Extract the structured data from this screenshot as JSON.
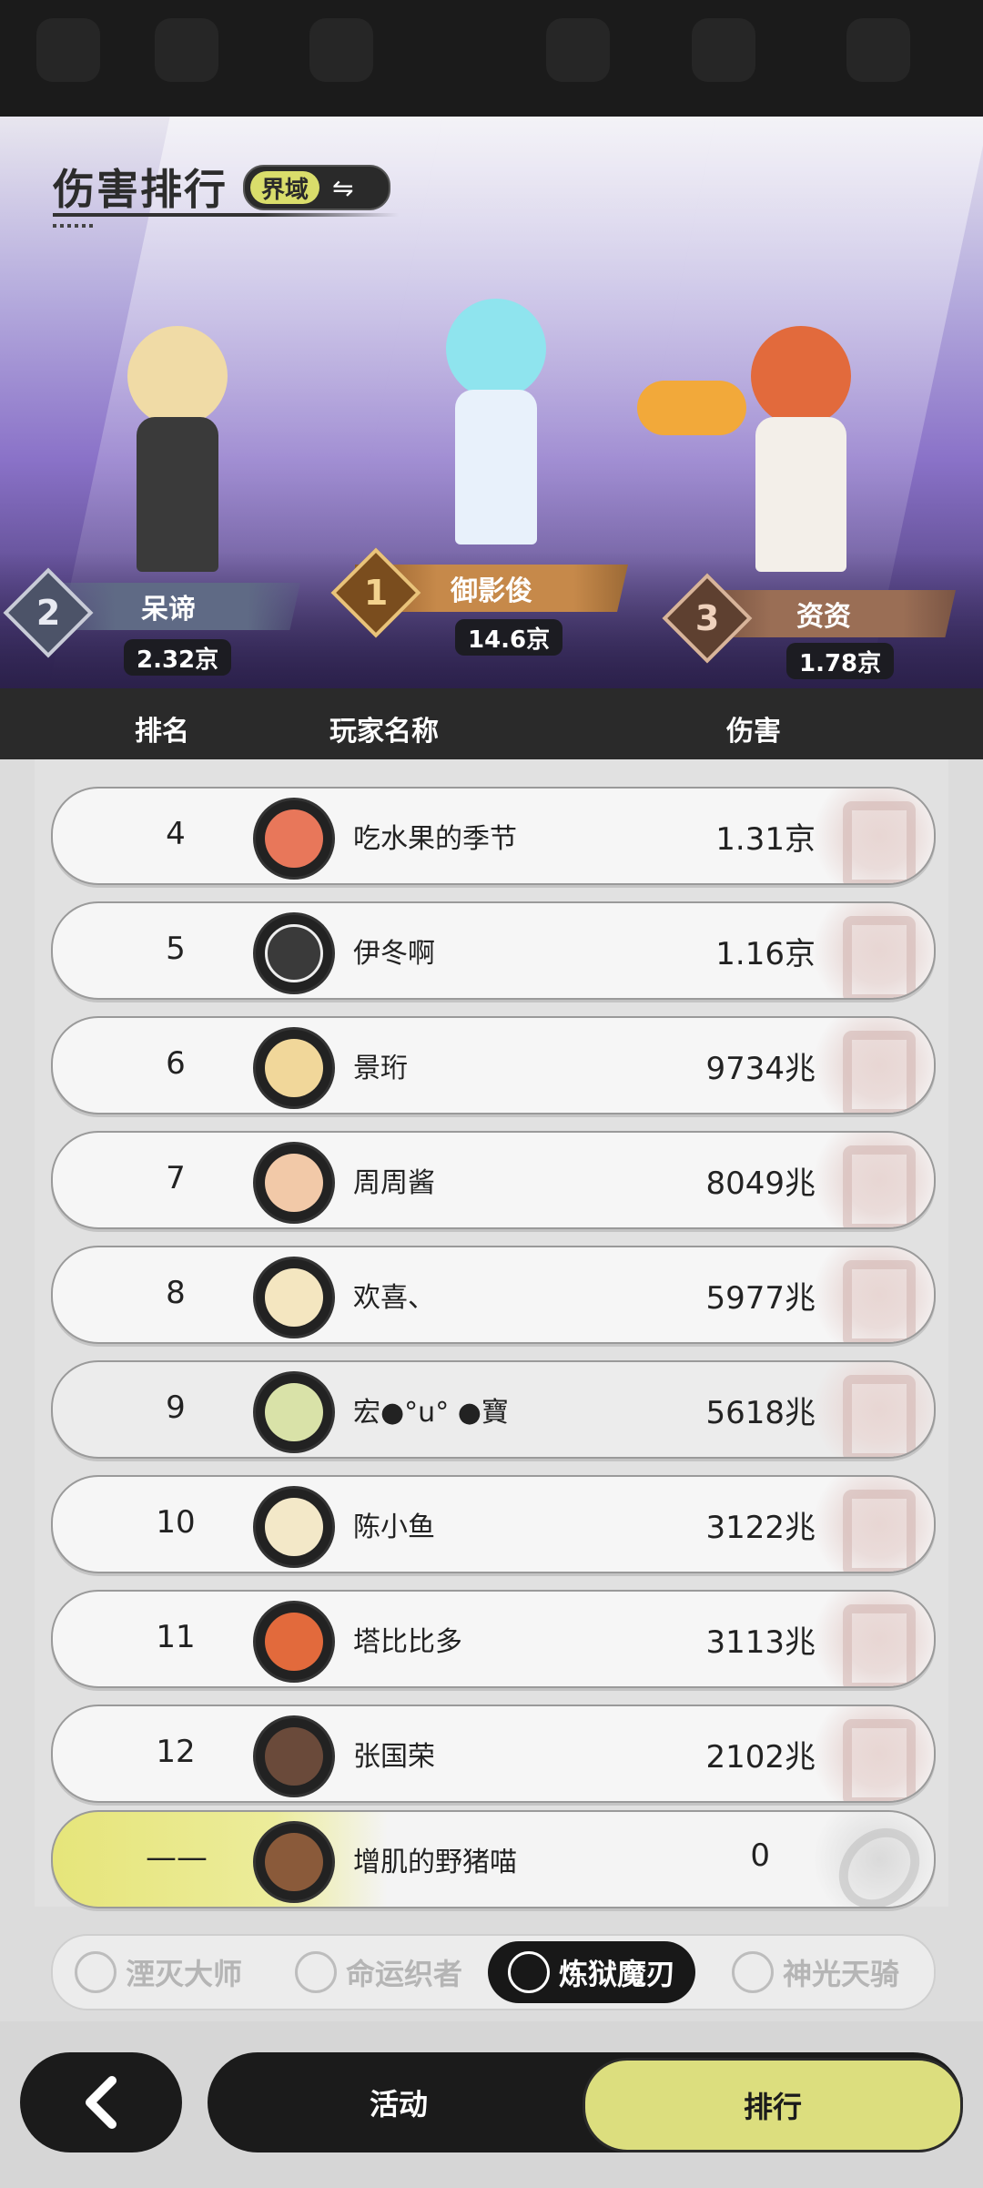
{
  "header": {
    "title": "伤害排行",
    "mode_label": "界域",
    "swap_icon": "⇋"
  },
  "podium": [
    {
      "rank": "2",
      "name": "呆谛",
      "damage": "2.32京"
    },
    {
      "rank": "1",
      "name": "御影俊",
      "damage": "14.6京"
    },
    {
      "rank": "3",
      "name": "资资",
      "damage": "1.78京"
    }
  ],
  "table": {
    "headers": {
      "rank": "排名",
      "player": "玩家名称",
      "damage": "伤害"
    },
    "rows": [
      {
        "rank": "4",
        "name": "吃水果的季节",
        "damage": "1.31京"
      },
      {
        "rank": "5",
        "name": "伊冬啊",
        "damage": "1.16京"
      },
      {
        "rank": "6",
        "name": "景珩",
        "damage": "9734兆"
      },
      {
        "rank": "7",
        "name": "周周酱",
        "damage": "8049兆"
      },
      {
        "rank": "8",
        "name": "欢喜、",
        "damage": "5977兆"
      },
      {
        "rank": "9",
        "name": "宏●°u° ●寶",
        "damage": "5618兆"
      },
      {
        "rank": "10",
        "name": "陈小鱼",
        "damage": "3122兆"
      },
      {
        "rank": "11",
        "name": "塔比比多",
        "damage": "3113兆"
      },
      {
        "rank": "12",
        "name": "张国荣",
        "damage": "2102兆"
      }
    ],
    "self_row": {
      "rank": "——",
      "name": "增肌的野猪喵",
      "damage": "0"
    }
  },
  "class_tabs": [
    {
      "label": "湮灭大师",
      "active": false
    },
    {
      "label": "命运织者",
      "active": false
    },
    {
      "label": "炼狱魔刃",
      "active": true
    },
    {
      "label": "神光天骑",
      "active": false
    }
  ],
  "bottom_nav": {
    "back_icon": "chevron-left-icon",
    "activity_label": "活动",
    "rank_label": "排行"
  },
  "colors": {
    "accent": "#dcde7e",
    "dark": "#1b1b1b",
    "scene_purple": "#8a72c8"
  }
}
